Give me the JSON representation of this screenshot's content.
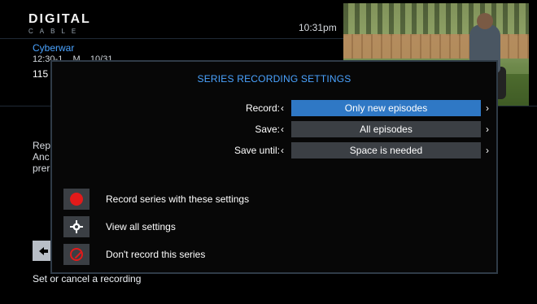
{
  "header": {
    "brand_title": "DIGITAL",
    "brand_subtitle": "CABLE",
    "time": "10:31pm"
  },
  "program": {
    "title": "Cyberwar",
    "time_partial": "12:30-1...  M... 10/31",
    "channel": "115",
    "description_lines_partial": [
      "Rep",
      "Anc",
      "prer"
    ],
    "status": "Set or cancel a recording"
  },
  "modal": {
    "title": "SERIES RECORDING SETTINGS",
    "settings": [
      {
        "label": "Record:",
        "value": "Only new episodes",
        "selected": true
      },
      {
        "label": "Save:",
        "value": "All episodes",
        "selected": false
      },
      {
        "label": "Save until:",
        "value": "Space is needed",
        "selected": false
      }
    ],
    "actions": [
      {
        "label": "Record series with these settings",
        "icon": "record-dot-icon"
      },
      {
        "label": "View all settings",
        "icon": "settings-gear-icon"
      },
      {
        "label": "Don't record this series",
        "icon": "no-symbol-icon"
      }
    ]
  },
  "colors": {
    "accent_blue": "#4aa3ff",
    "selected_field": "#2f78c5",
    "field_bg": "#3b3f44",
    "danger": "#e21a1a"
  }
}
